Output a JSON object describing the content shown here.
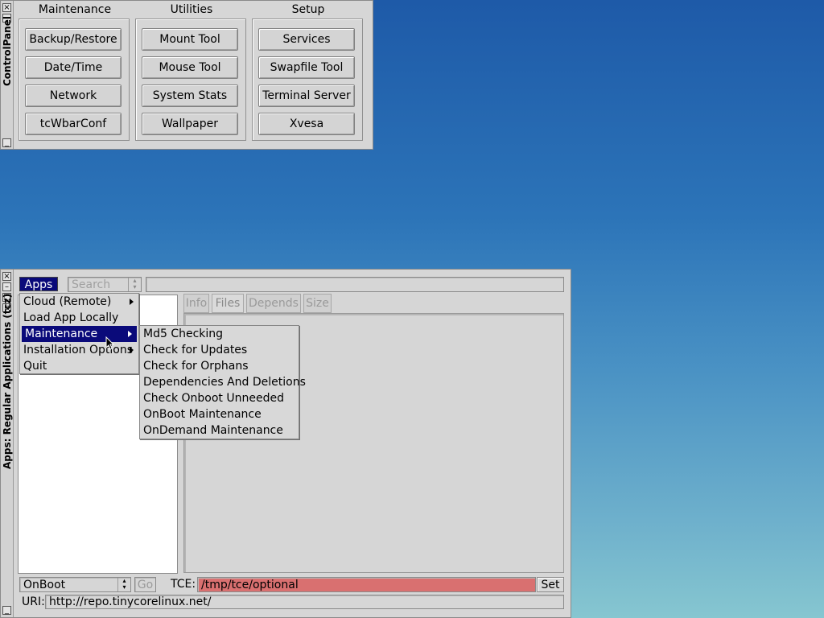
{
  "control_panel": {
    "title": "ControlPanel",
    "groups": [
      {
        "label": "Maintenance",
        "buttons": [
          "Backup/Restore",
          "Date/Time",
          "Network",
          "tcWbarConf"
        ]
      },
      {
        "label": "Utilities",
        "buttons": [
          "Mount Tool",
          "Mouse Tool",
          "System Stats",
          "Wallpaper"
        ]
      },
      {
        "label": "Setup",
        "buttons": [
          "Services",
          "Swapfile Tool",
          "Terminal Server",
          "Xvesa"
        ]
      }
    ]
  },
  "apps_window": {
    "title": "Apps: Regular Applications (tcz)",
    "menu_button": "Apps",
    "search_placeholder": "Search",
    "tabs": [
      "Info",
      "Files",
      "Depends",
      "Size"
    ],
    "onboot_select": "OnBoot",
    "go_label": "Go",
    "tce_label": "TCE:",
    "tce_value": "/tmp/tce/optional",
    "set_label": "Set",
    "uri_label": "URI:",
    "uri_value": "http://repo.tinycorelinux.net/"
  },
  "apps_menu": {
    "items": [
      {
        "label": "Cloud (Remote)",
        "submenu": true
      },
      {
        "label": "Load App Locally",
        "submenu": false
      },
      {
        "label": "Maintenance",
        "submenu": true,
        "selected": true
      },
      {
        "label": "Installation Options",
        "submenu": true
      },
      {
        "label": "Quit",
        "submenu": false
      }
    ]
  },
  "maintenance_submenu": {
    "items": [
      "Md5 Checking",
      "Check for Updates",
      "Check for Orphans",
      "Dependencies And Deletions",
      "Check Onboot Unneeded",
      "OnBoot Maintenance",
      "OnDemand Maintenance"
    ]
  },
  "colors": {
    "desktop_top": "#1e5aa8",
    "desktop_bottom": "#86c6d0",
    "menu_highlight": "#0a0a7a",
    "tce_field": "#d97070"
  }
}
